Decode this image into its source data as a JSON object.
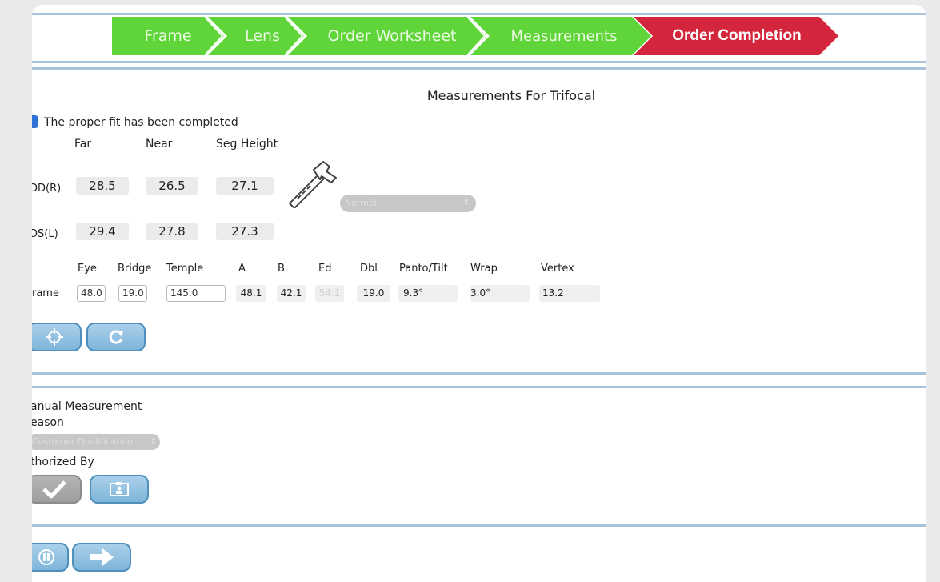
{
  "breadcrumb": {
    "steps": [
      "Frame",
      "Lens",
      "Order Worksheet",
      "Measurements",
      "Order Completion"
    ],
    "current": "Order Completion"
  },
  "measurements": {
    "title": "Measurements For Trifocal",
    "fit_label": "The proper fit has been completed",
    "fit_checked": true,
    "columns": [
      "Far",
      "Near",
      "Seg Height"
    ],
    "od_label": "DD(R)",
    "od_values": [
      "28.5",
      "26.5",
      "27.1"
    ],
    "os_label": "DS(L)",
    "os_values": [
      "29.4",
      "27.8",
      "27.3"
    ],
    "mode_select": "Normal",
    "frame_headers": [
      "Eye",
      "Bridge",
      "Temple",
      "A",
      "B",
      "Ed",
      "Dbl",
      "Panto/Tilt",
      "Wrap",
      "Vertex"
    ],
    "frame_label": "rame",
    "frame": {
      "eye": "48.0",
      "bridge": "19.0",
      "temple": "145.0",
      "a": "48.1",
      "b": "42.1",
      "ed": "54.1",
      "dbl": "19.0",
      "panto": "9.3°",
      "wrap": "3.0°",
      "vertex": "13.2"
    }
  },
  "manual": {
    "heading": "anual Measurement",
    "reason_label": "eason",
    "reason_select": "Customer Qualification",
    "authorized_label": "thorized By"
  },
  "icons": {
    "caliper": "caliper-icon",
    "target": "crosshair-icon",
    "refresh": "refresh-icon",
    "approve": "checkmark-icon",
    "id": "id-card-icon",
    "pause": "pause-icon",
    "next": "arrow-right-icon"
  },
  "colors": {
    "step_done": "#5fd53a",
    "step_current": "#d3253b",
    "divider": "#a9c3da",
    "button": "#8cbfe1"
  }
}
